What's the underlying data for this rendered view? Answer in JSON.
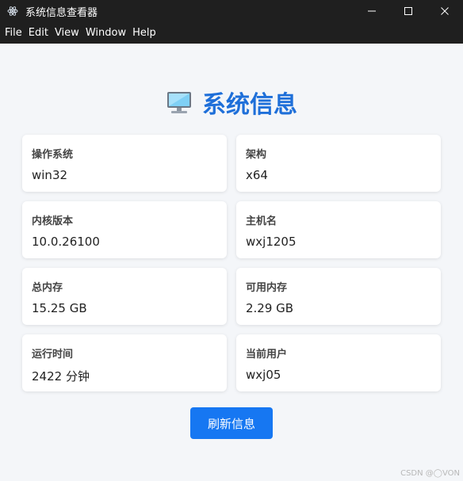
{
  "window": {
    "title": "系统信息查看器",
    "controls": {
      "minimize": "—",
      "maximize": "☐",
      "close": "✕"
    }
  },
  "menu": {
    "items": [
      "File",
      "Edit",
      "View",
      "Window",
      "Help"
    ]
  },
  "main": {
    "heading": "系统信息",
    "heading_icon": "computer-monitor-icon",
    "cards": [
      {
        "label": "操作系统",
        "value": "win32"
      },
      {
        "label": "架构",
        "value": "x64"
      },
      {
        "label": "内核版本",
        "value": "10.0.26100"
      },
      {
        "label": "主机名",
        "value": "wxj1205"
      },
      {
        "label": "总内存",
        "value": "15.25 GB"
      },
      {
        "label": "可用内存",
        "value": "2.29 GB"
      },
      {
        "label": "运行时间",
        "value": "2422 分钟"
      },
      {
        "label": "当前用户",
        "value": "wxj05"
      }
    ],
    "refresh_label": "刷新信息"
  },
  "watermark": "CSDN @◯VON",
  "colors": {
    "accent": "#1e6fd9",
    "button": "#1677f2",
    "titlebar": "#1f1f1f",
    "background": "#f4f6f9"
  }
}
